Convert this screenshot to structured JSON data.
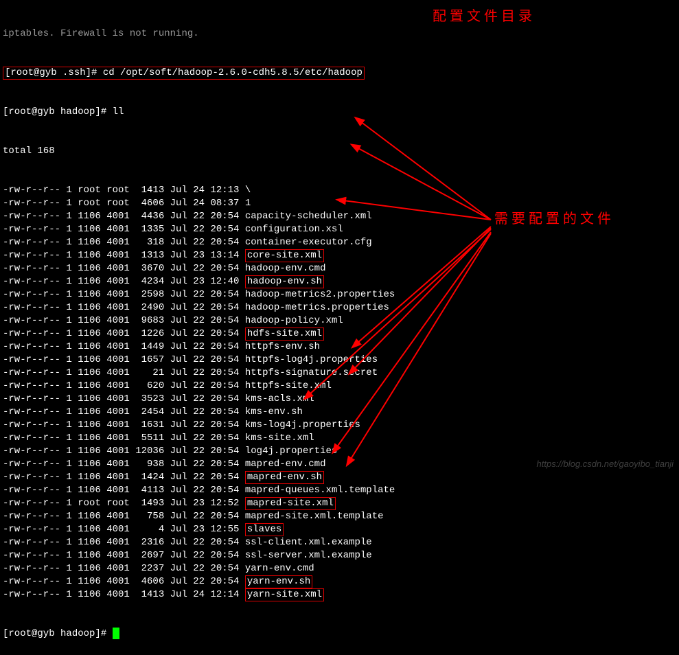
{
  "header_trunc": "iptables. Firewall is not running.",
  "prompt1_prefix": "[root@gyb .ssh]# ",
  "cmd1": "cd /opt/soft/hadoop-2.6.0-cdh5.8.5/etc/hadoop",
  "prompt2": "[root@gyb hadoop]# ll",
  "total": "total 168",
  "rows": [
    {
      "perm": "-rw-r--r-- 1 root root  1413 Jul 24 12:13 ",
      "name": "\\",
      "hl": false
    },
    {
      "perm": "-rw-r--r-- 1 root root  4606 Jul 24 08:37 ",
      "name": "1",
      "hl": false
    },
    {
      "perm": "-rw-r--r-- 1 1106 4001  4436 Jul 22 20:54 ",
      "name": "capacity-scheduler.xml",
      "hl": false
    },
    {
      "perm": "-rw-r--r-- 1 1106 4001  1335 Jul 22 20:54 ",
      "name": "configuration.xsl",
      "hl": false
    },
    {
      "perm": "-rw-r--r-- 1 1106 4001   318 Jul 22 20:54 ",
      "name": "container-executor.cfg",
      "hl": false
    },
    {
      "perm": "-rw-r--r-- 1 1106 4001  1313 Jul 23 13:14 ",
      "name": "core-site.xml",
      "hl": true
    },
    {
      "perm": "-rw-r--r-- 1 1106 4001  3670 Jul 22 20:54 ",
      "name": "hadoop-env.cmd",
      "hl": false
    },
    {
      "perm": "-rw-r--r-- 1 1106 4001  4234 Jul 23 12:40 ",
      "name": "hadoop-env.sh",
      "hl": true
    },
    {
      "perm": "-rw-r--r-- 1 1106 4001  2598 Jul 22 20:54 ",
      "name": "hadoop-metrics2.properties",
      "hl": false
    },
    {
      "perm": "-rw-r--r-- 1 1106 4001  2490 Jul 22 20:54 ",
      "name": "hadoop-metrics.properties",
      "hl": false
    },
    {
      "perm": "-rw-r--r-- 1 1106 4001  9683 Jul 22 20:54 ",
      "name": "hadoop-policy.xml",
      "hl": false
    },
    {
      "perm": "-rw-r--r-- 1 1106 4001  1226 Jul 22 20:54 ",
      "name": "hdfs-site.xml",
      "hl": true
    },
    {
      "perm": "-rw-r--r-- 1 1106 4001  1449 Jul 22 20:54 ",
      "name": "httpfs-env.sh",
      "hl": false
    },
    {
      "perm": "-rw-r--r-- 1 1106 4001  1657 Jul 22 20:54 ",
      "name": "httpfs-log4j.properties",
      "hl": false
    },
    {
      "perm": "-rw-r--r-- 1 1106 4001    21 Jul 22 20:54 ",
      "name": "httpfs-signature.secret",
      "hl": false
    },
    {
      "perm": "-rw-r--r-- 1 1106 4001   620 Jul 22 20:54 ",
      "name": "httpfs-site.xml",
      "hl": false
    },
    {
      "perm": "-rw-r--r-- 1 1106 4001  3523 Jul 22 20:54 ",
      "name": "kms-acls.xml",
      "hl": false
    },
    {
      "perm": "-rw-r--r-- 1 1106 4001  2454 Jul 22 20:54 ",
      "name": "kms-env.sh",
      "hl": false
    },
    {
      "perm": "-rw-r--r-- 1 1106 4001  1631 Jul 22 20:54 ",
      "name": "kms-log4j.properties",
      "hl": false
    },
    {
      "perm": "-rw-r--r-- 1 1106 4001  5511 Jul 22 20:54 ",
      "name": "kms-site.xml",
      "hl": false
    },
    {
      "perm": "-rw-r--r-- 1 1106 4001 12036 Jul 22 20:54 ",
      "name": "log4j.properties",
      "hl": false
    },
    {
      "perm": "-rw-r--r-- 1 1106 4001   938 Jul 22 20:54 ",
      "name": "mapred-env.cmd",
      "hl": false
    },
    {
      "perm": "-rw-r--r-- 1 1106 4001  1424 Jul 22 20:54 ",
      "name": "mapred-env.sh",
      "hl": true
    },
    {
      "perm": "-rw-r--r-- 1 1106 4001  4113 Jul 22 20:54 ",
      "name": "mapred-queues.xml.template",
      "hl": false
    },
    {
      "perm": "-rw-r--r-- 1 root root  1493 Jul 23 12:52 ",
      "name": "mapred-site.xml",
      "hl": true
    },
    {
      "perm": "-rw-r--r-- 1 1106 4001   758 Jul 22 20:54 ",
      "name": "mapred-site.xml.template",
      "hl": false
    },
    {
      "perm": "-rw-r--r-- 1 1106 4001     4 Jul 23 12:55 ",
      "name": "slaves",
      "hl": true
    },
    {
      "perm": "-rw-r--r-- 1 1106 4001  2316 Jul 22 20:54 ",
      "name": "ssl-client.xml.example",
      "hl": false
    },
    {
      "perm": "-rw-r--r-- 1 1106 4001  2697 Jul 22 20:54 ",
      "name": "ssl-server.xml.example",
      "hl": false
    },
    {
      "perm": "-rw-r--r-- 1 1106 4001  2237 Jul 22 20:54 ",
      "name": "yarn-env.cmd",
      "hl": false
    },
    {
      "perm": "-rw-r--r-- 1 1106 4001  4606 Jul 22 20:54 ",
      "name": "yarn-env.sh",
      "hl": true
    },
    {
      "perm": "-rw-r--r-- 1 1106 4001  1413 Jul 24 12:14 ",
      "name": "yarn-site.xml",
      "hl": true
    }
  ],
  "prompt3": "[root@gyb hadoop]# ",
  "annotation1": "配置文件目录",
  "annotation2": "需要配置的文件",
  "watermark": "https://blog.csdn.net/gaoyibo_tianji"
}
